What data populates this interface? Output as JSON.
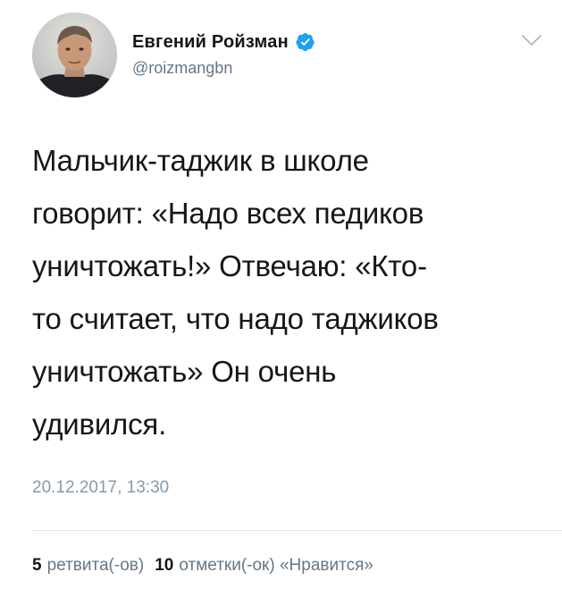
{
  "author": {
    "display_name": "Евгений Ройзман",
    "handle": "@roizmangbn",
    "verified": true,
    "avatar_icon": "user-avatar-photo"
  },
  "tweet": {
    "text": "Мальчик-таджик в школе\nговорит: «Надо всех педиков\nуничтожать!» Отвечаю: «Кто-\nто считает, что надо таджиков\nуничтожать» Он очень\nудивился.",
    "timestamp": "20.12.2017, 13:30"
  },
  "stats": {
    "retweets_count": "5",
    "retweets_label": "ретвита(-ов)",
    "likes_count": "10",
    "likes_label": "отметки(-ок) «Нравится»"
  },
  "icons": {
    "verified": "verified-badge-icon",
    "menu": "chevron-down-icon"
  },
  "colors": {
    "verified_blue": "#1da1f2",
    "secondary_text": "#657786",
    "timestamp_text": "#8899a6",
    "primary_text": "#14171a"
  }
}
